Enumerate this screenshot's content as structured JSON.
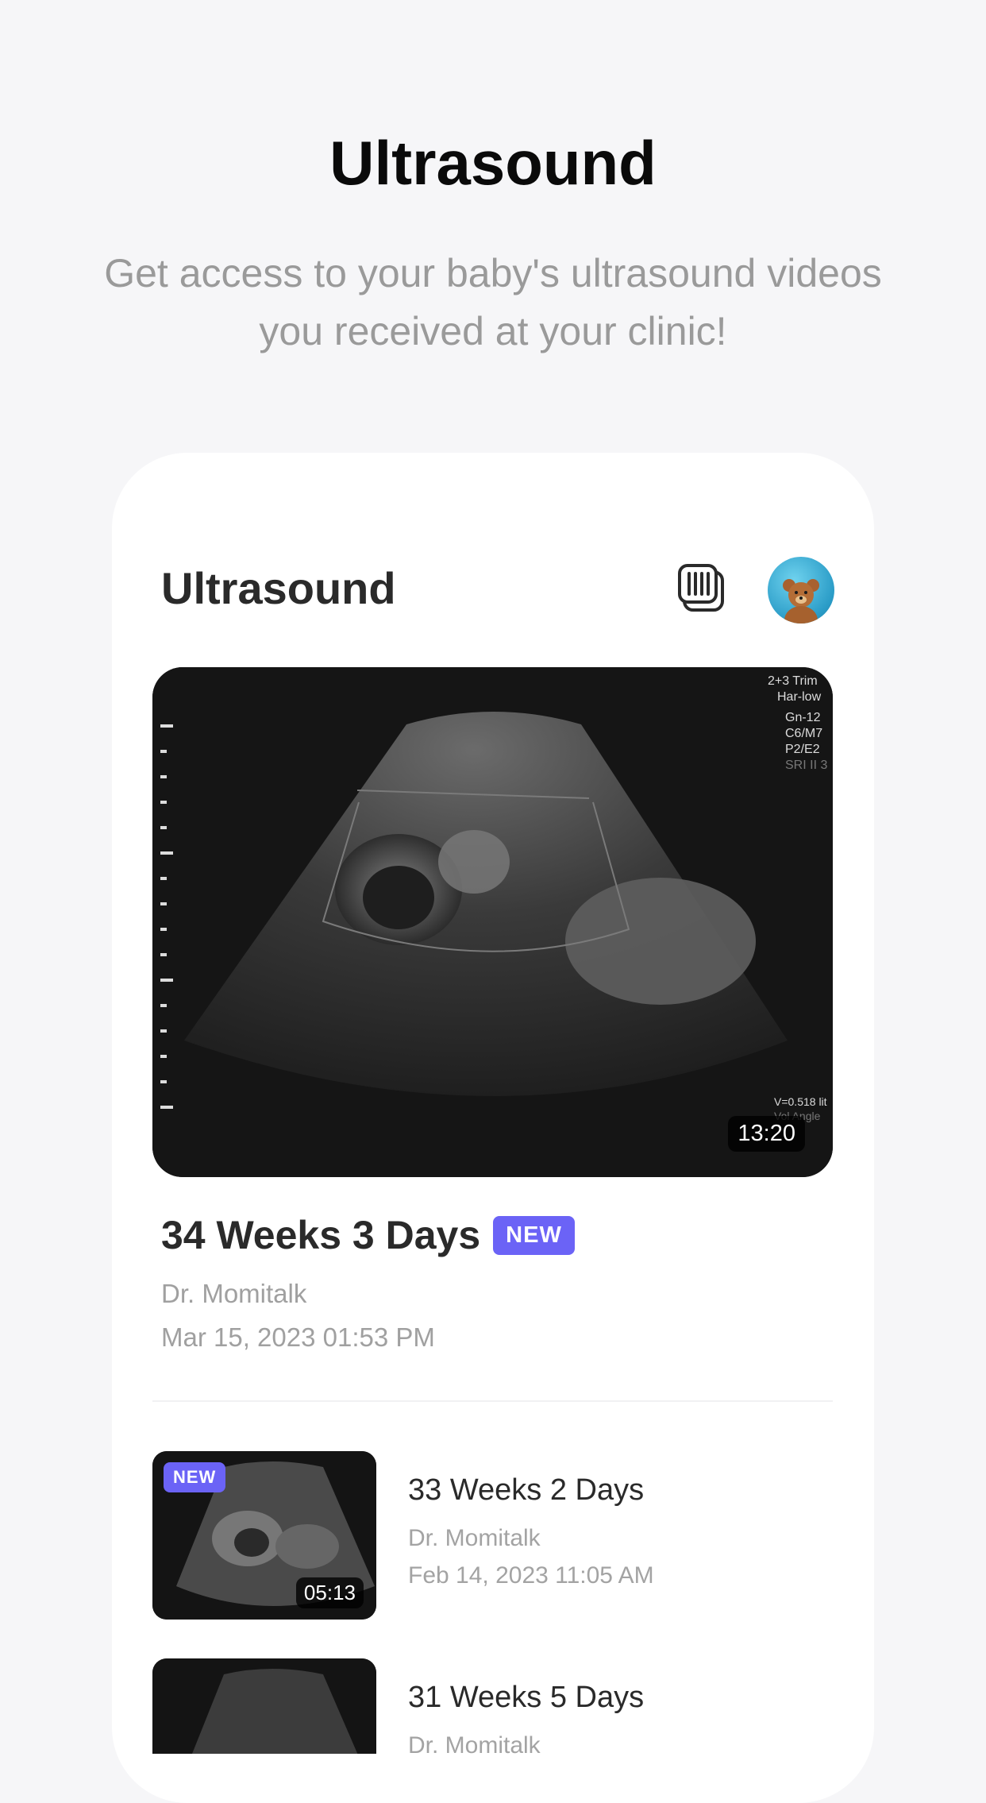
{
  "page": {
    "title": "Ultrasound",
    "subtitle": "Get access to your baby's ultrasound videos you received at your clinic!"
  },
  "card": {
    "title": "Ultrasound",
    "icons": [
      "video-list-icon",
      "teddy-bear-avatar"
    ],
    "featured": {
      "title": "34 Weeks 3 Days",
      "badge": "NEW",
      "doctor": "Dr. Momitalk",
      "date": "Mar 15, 2023 01:53 PM",
      "duration": "13:20",
      "overlay_top_right": [
        "2+3 Trim",
        "Har-low",
        "Gn-12",
        "C6/M7",
        "P2/E2",
        "SRI II 3"
      ],
      "overlay_bottom_right": [
        "V=0.518 lit",
        "Vol Angle"
      ]
    },
    "items": [
      {
        "title": "33 Weeks 2 Days",
        "badge": "NEW",
        "doctor": "Dr. Momitalk",
        "date": "Feb 14, 2023 11:05 AM",
        "duration": "05:13"
      },
      {
        "title": "31 Weeks 5 Days",
        "doctor": "Dr. Momitalk"
      }
    ]
  },
  "colors": {
    "accent": "#6b63f6",
    "background": "#f6f6f8",
    "card": "#ffffff"
  }
}
